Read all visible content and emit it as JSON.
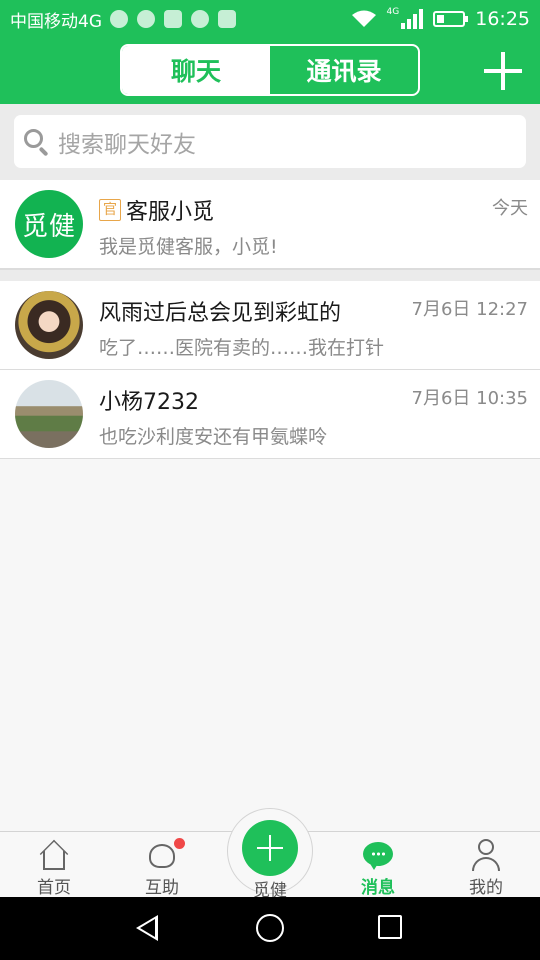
{
  "status_bar": {
    "carrier": "中国移动4G",
    "network_badge": "4G",
    "time": "16:25",
    "battery_level": 0.3,
    "icons": [
      "app-notification-icon",
      "emoji-icon",
      "app-icon",
      "wechat-icon",
      "image-icon",
      "wifi-icon",
      "signal-icon",
      "battery-icon"
    ]
  },
  "header": {
    "tabs": [
      {
        "label": "聊天",
        "active": true
      },
      {
        "label": "通讯录",
        "active": false
      }
    ],
    "add_icon": "plus-icon"
  },
  "search": {
    "placeholder": "搜索聊天好友",
    "icon": "search-icon"
  },
  "chats": [
    {
      "avatar_text": "觅健",
      "badge": "官",
      "name": "客服小觅",
      "time": "今天",
      "message": "我是觅健客服，小觅!"
    },
    {
      "name": "风雨过后总会见到彩虹的",
      "time": "7月6日 12:27",
      "message": "吃了……医院有卖的……我在打针"
    },
    {
      "name": "小杨7232",
      "time": "7月6日 10:35",
      "message": "也吃沙利度安还有甲氨蝶呤"
    }
  ],
  "bottom_nav": {
    "items": [
      {
        "label": "首页",
        "icon": "home-icon",
        "active": false
      },
      {
        "label": "互助",
        "icon": "heart-icon",
        "active": false,
        "has_dot": true
      },
      {
        "label": "觅健",
        "icon": "plus-icon",
        "active": false
      },
      {
        "label": "消息",
        "icon": "message-icon",
        "active": true
      },
      {
        "label": "我的",
        "icon": "user-icon",
        "active": false
      }
    ]
  },
  "colors": {
    "brand_green": "#1fc05a",
    "badge_orange": "#e8a64a",
    "notification_red": "#f04848"
  }
}
